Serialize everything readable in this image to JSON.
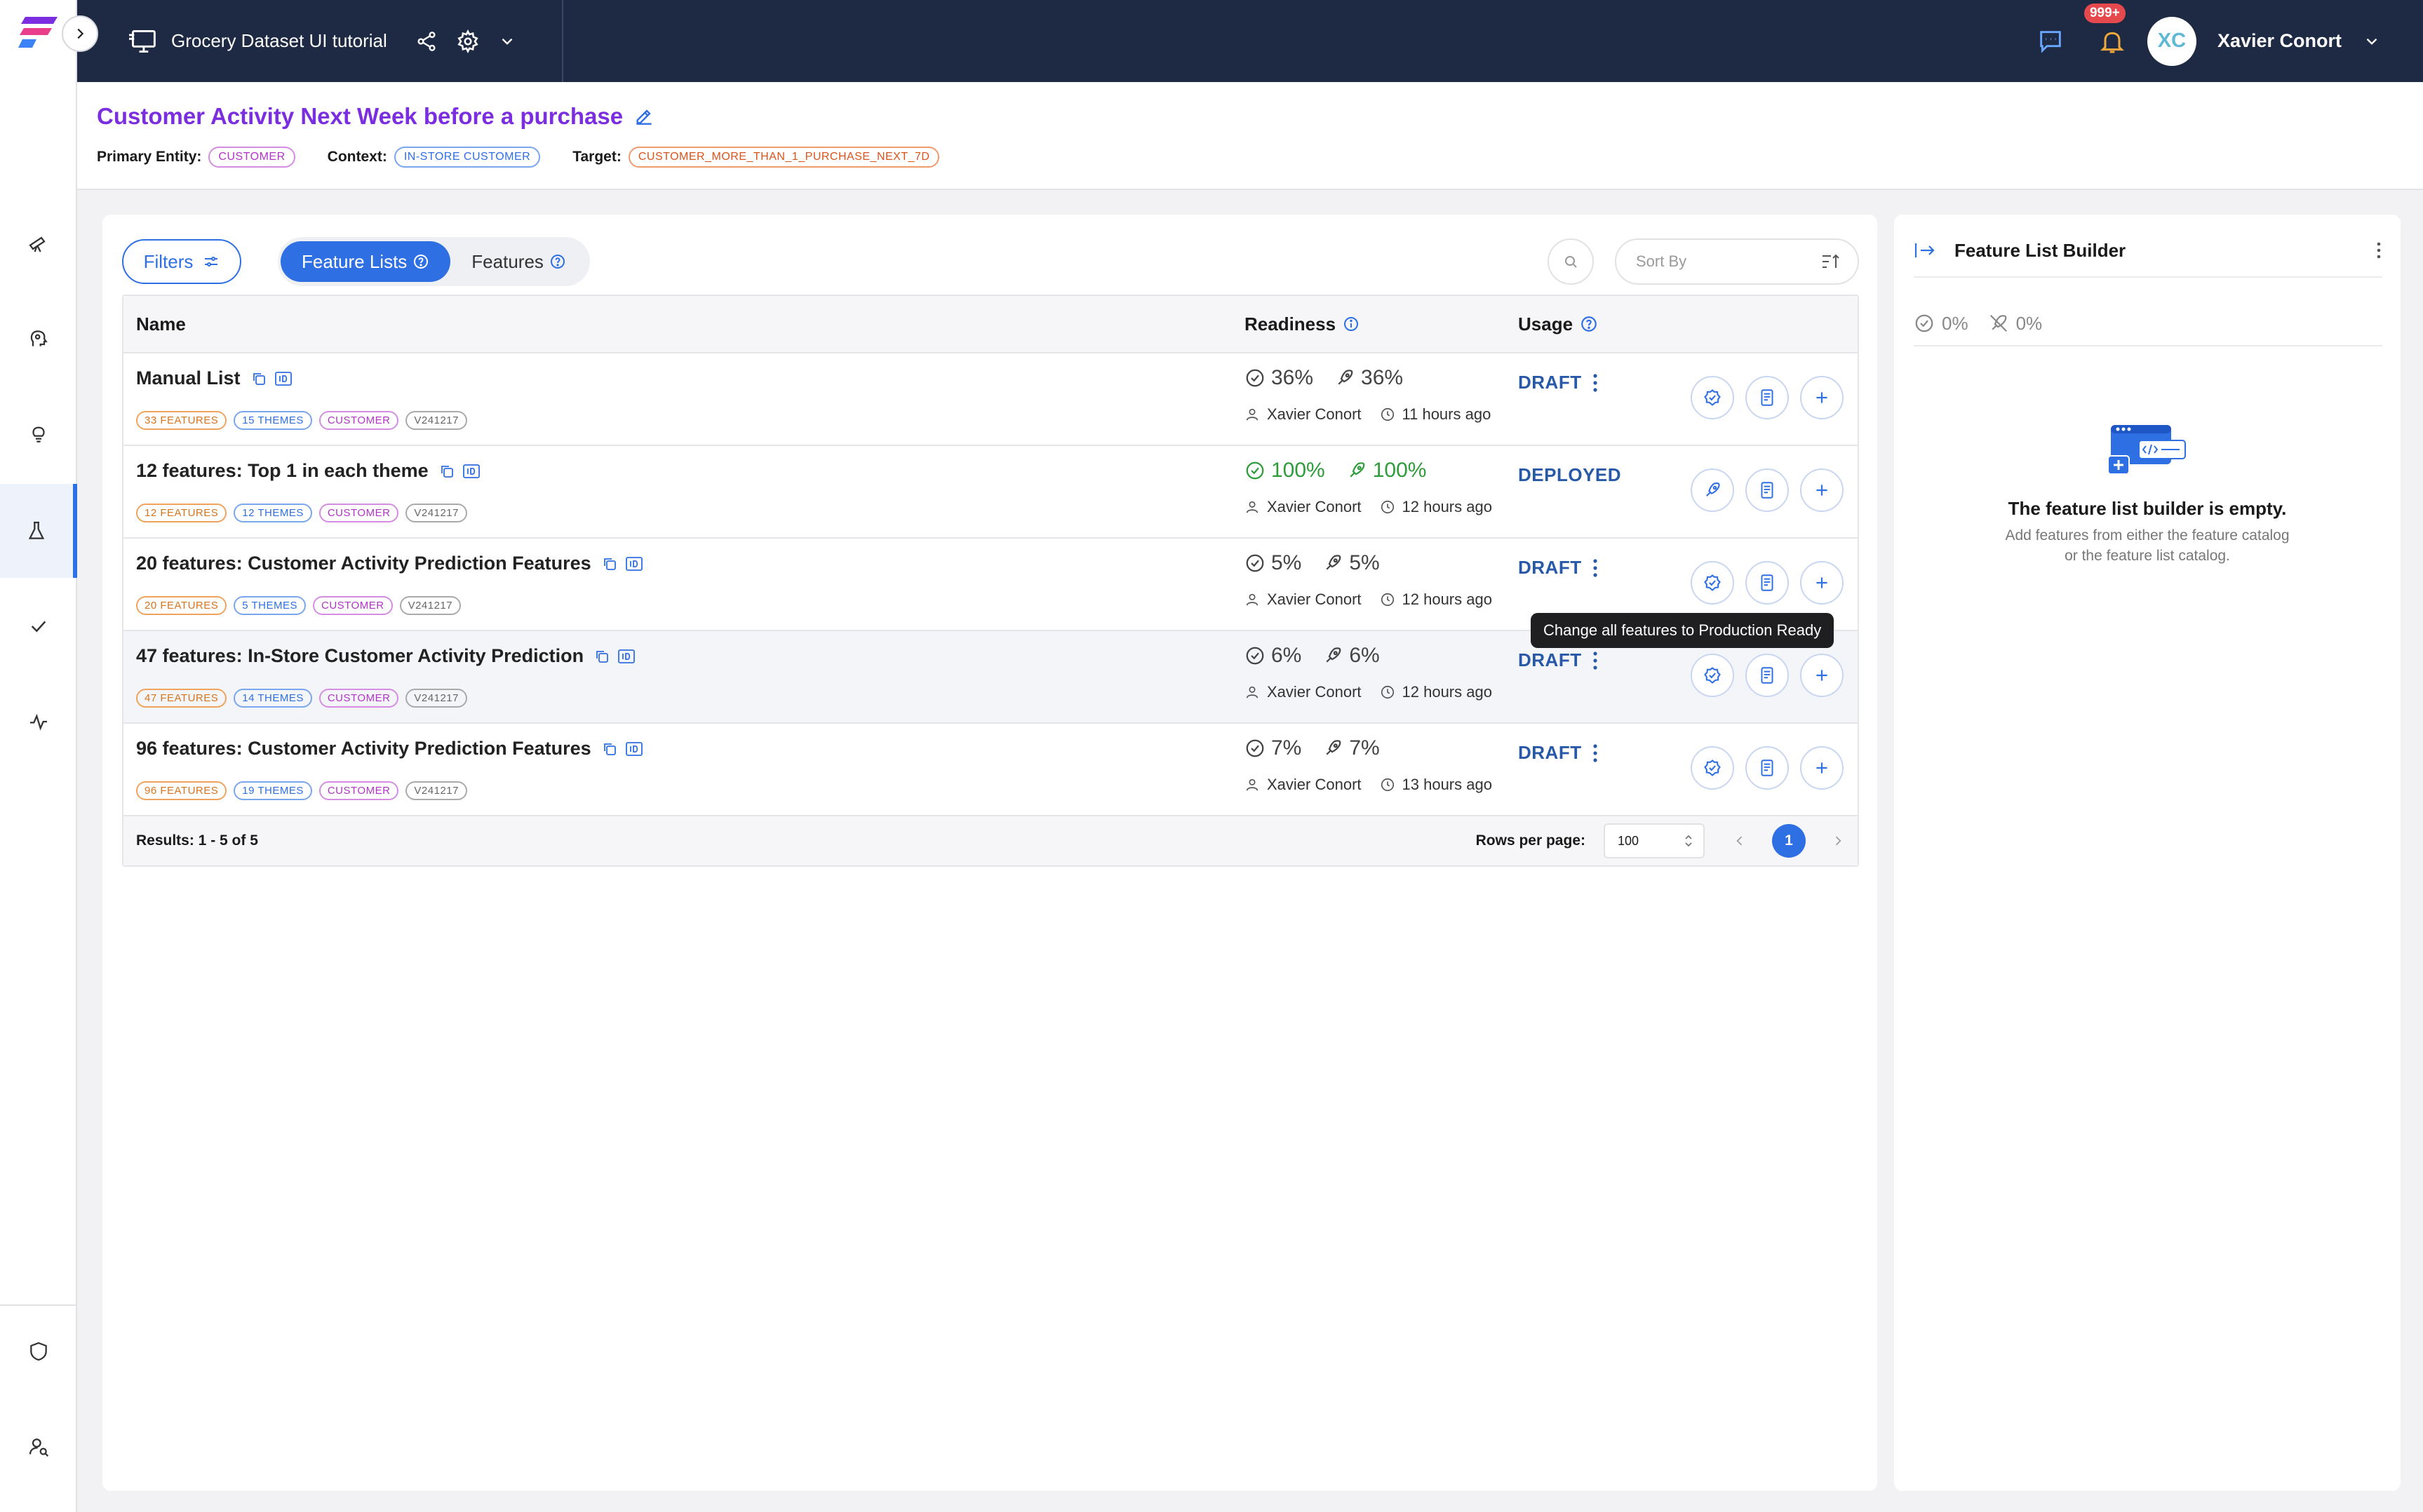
{
  "topbar": {
    "title": "Grocery Dataset UI tutorial",
    "notifications": "999+",
    "avatar_initials": "XC",
    "user_name": "Xavier Conort"
  },
  "header": {
    "title": "Customer Activity Next Week before a purchase",
    "primary_entity_label": "Primary Entity:",
    "primary_entity": "CUSTOMER",
    "context_label": "Context:",
    "context": "IN-STORE CUSTOMER",
    "target_label": "Target:",
    "target": "CUSTOMER_MORE_THAN_1_PURCHASE_NEXT_7D"
  },
  "toolbar": {
    "filters_label": "Filters",
    "tab_feature_lists": "Feature Lists",
    "tab_features": "Features",
    "sort_placeholder": "Sort By"
  },
  "table": {
    "columns": {
      "name": "Name",
      "readiness": "Readiness",
      "usage": "Usage"
    },
    "rows": [
      {
        "name": "Manual List",
        "features": "33 FEATURES",
        "themes": "15 THEMES",
        "entity": "CUSTOMER",
        "version": "V241217",
        "ready": "36%",
        "online": "36%",
        "owner": "Xavier Conort",
        "time": "11 hours ago",
        "usage": "DRAFT"
      },
      {
        "name": "12 features: Top 1 in each theme",
        "features": "12 FEATURES",
        "themes": "12 THEMES",
        "entity": "CUSTOMER",
        "version": "V241217",
        "ready": "100%",
        "online": "100%",
        "owner": "Xavier Conort",
        "time": "12 hours ago",
        "usage": "DEPLOYED"
      },
      {
        "name": "20 features: Customer Activity Prediction Features",
        "features": "20 FEATURES",
        "themes": "5 THEMES",
        "entity": "CUSTOMER",
        "version": "V241217",
        "ready": "5%",
        "online": "5%",
        "owner": "Xavier Conort",
        "time": "12 hours ago",
        "usage": "DRAFT"
      },
      {
        "name": "47 features: In-Store Customer Activity Prediction",
        "features": "47 FEATURES",
        "themes": "14 THEMES",
        "entity": "CUSTOMER",
        "version": "V241217",
        "ready": "6%",
        "online": "6%",
        "owner": "Xavier Conort",
        "time": "12 hours ago",
        "usage": "DRAFT"
      },
      {
        "name": "96 features: Customer Activity Prediction Features",
        "features": "96 FEATURES",
        "themes": "19 THEMES",
        "entity": "CUSTOMER",
        "version": "V241217",
        "ready": "7%",
        "online": "7%",
        "owner": "Xavier Conort",
        "time": "13 hours ago",
        "usage": "DRAFT"
      }
    ],
    "results": "Results: 1 - 5 of 5",
    "rows_per_page_label": "Rows per page:",
    "rows_per_page": "100",
    "page": "1",
    "tooltip": "Change all features to Production Ready"
  },
  "panel": {
    "title": "Feature List Builder",
    "ready": "0%",
    "online": "0%",
    "empty_title": "The feature list builder is empty.",
    "empty_line1": "Add features from either the feature catalog",
    "empty_line2": "or the feature list catalog."
  },
  "colors": {
    "accent": "#2f6fe4",
    "title_purple": "#7a2ee0",
    "topbar": "#1e2a44",
    "deployed_green": "#2e9c3a"
  }
}
